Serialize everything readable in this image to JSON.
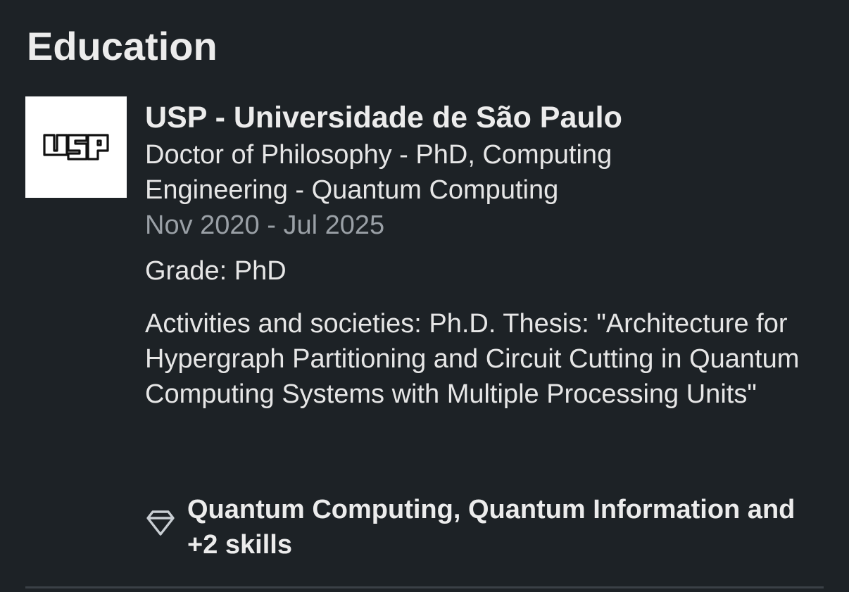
{
  "section": {
    "title": "Education"
  },
  "education": {
    "logo_text": "USP",
    "school": "USP - Universidade de São Paulo",
    "degree": "Doctor of Philosophy - PhD, Computing Engineering - Quantum Computing",
    "dates": "Nov 2020 - Jul 2025",
    "grade": "Grade: PhD",
    "activities": "Activities and societies: Ph.D. Thesis: \"Architecture for Hypergraph Partitioning and Circuit Cutting in Quantum Computing Systems with Multiple Processing Units\"",
    "skills": "Quantum Computing, Quantum Information and +2 skills",
    "skills_icon": "diamond-icon"
  },
  "colors": {
    "background": "#1d2226",
    "primary_text": "#ececec",
    "secondary_text": "#9aa0a6",
    "divider": "#3a4046"
  }
}
